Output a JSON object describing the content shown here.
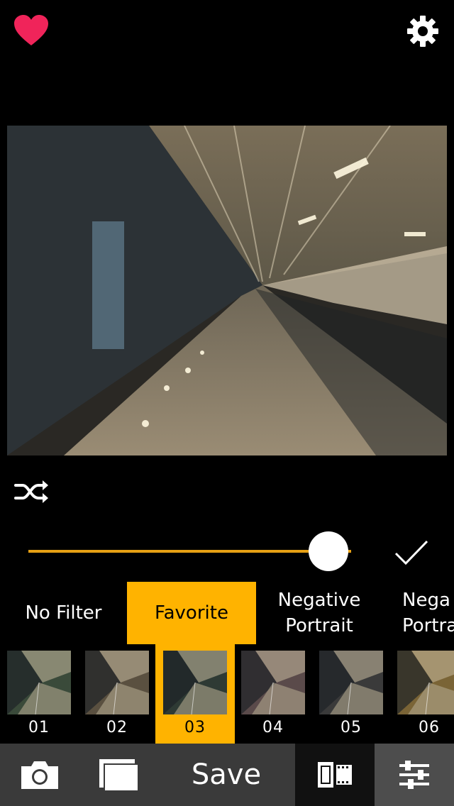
{
  "filters": {
    "categories": [
      {
        "label": "No Filter",
        "selected": false
      },
      {
        "label": "Favorite",
        "selected": true
      },
      {
        "label": "Negative\nPortrait",
        "selected": false
      },
      {
        "label": "Nega\nPortra",
        "selected": false
      }
    ],
    "thumbnails": [
      {
        "label": "01",
        "tint": "#3a4a3a",
        "selected": false
      },
      {
        "label": "02",
        "tint": "#5a5040",
        "selected": false
      },
      {
        "label": "03",
        "tint": "#2e3a34",
        "selected": true
      },
      {
        "label": "04",
        "tint": "#5a4a4a",
        "selected": false
      },
      {
        "label": "05",
        "tint": "#3a3a3a",
        "selected": false
      },
      {
        "label": "06",
        "tint": "#7a6436",
        "selected": false
      }
    ]
  },
  "slider": {
    "value_fraction": 0.93
  },
  "toolbar": {
    "save_label": "Save"
  },
  "colors": {
    "accent": "#ffb300",
    "heart": "#f0245a",
    "track": "#e6a014"
  },
  "icons": [
    "heart-icon",
    "settings-gear-icon",
    "shuffle-icon",
    "check-icon",
    "camera-icon",
    "gallery-icon",
    "filmstrip-icon",
    "sliders-icon"
  ]
}
